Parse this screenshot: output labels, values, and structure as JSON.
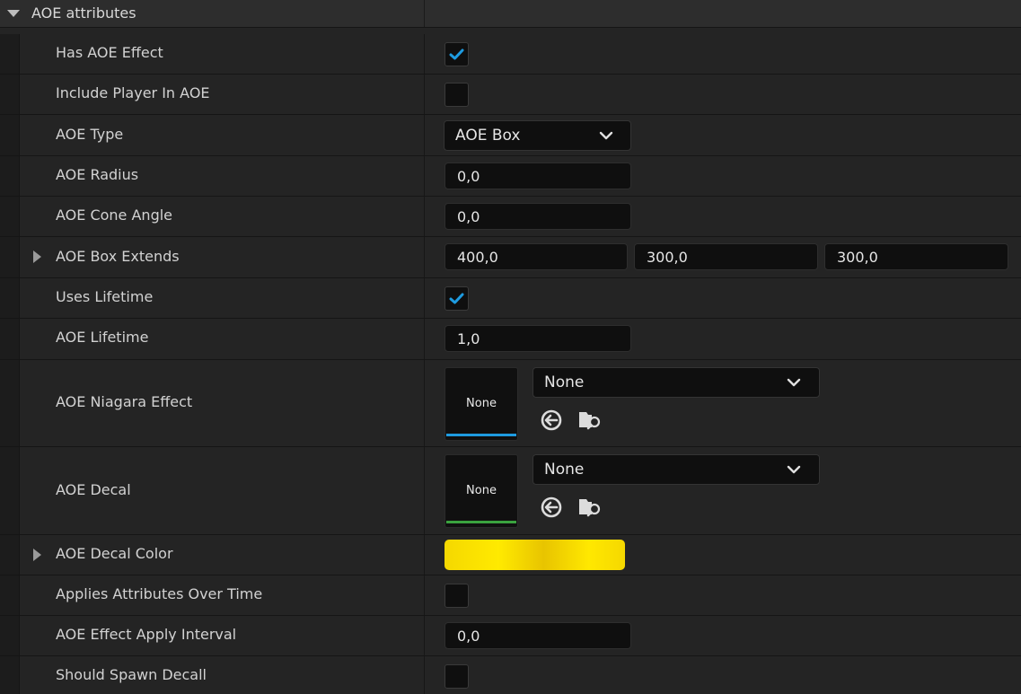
{
  "section": {
    "title": "AOE attributes"
  },
  "rows": {
    "has_aoe_effect": {
      "label": "Has AOE Effect",
      "checked": true
    },
    "include_player": {
      "label": "Include Player In AOE",
      "checked": false
    },
    "aoe_type": {
      "label": "AOE Type",
      "value": "AOE Box"
    },
    "aoe_radius": {
      "label": "AOE Radius",
      "value": "0,0"
    },
    "aoe_cone_angle": {
      "label": "AOE Cone Angle",
      "value": "0,0"
    },
    "aoe_box_extends": {
      "label": "AOE Box Extends",
      "x": "400,0",
      "y": "300,0",
      "z": "300,0"
    },
    "uses_lifetime": {
      "label": "Uses Lifetime",
      "checked": true
    },
    "aoe_lifetime": {
      "label": "AOE Lifetime",
      "value": "1,0"
    },
    "aoe_niagara_effect": {
      "label": "AOE Niagara Effect",
      "thumb_text": "None",
      "value": "None",
      "accent": "#1e9be0"
    },
    "aoe_decal": {
      "label": "AOE Decal",
      "thumb_text": "None",
      "value": "None",
      "accent": "#3aa23f"
    },
    "aoe_decal_color": {
      "label": "AOE Decal Color",
      "color": "#f5d800"
    },
    "applies_over_time": {
      "label": "Applies Attributes Over Time",
      "checked": false
    },
    "apply_interval": {
      "label": "AOE Effect Apply Interval",
      "value": "0,0"
    },
    "should_spawn_decal": {
      "label": "Should Spawn Decall",
      "checked": false
    }
  },
  "icons": {
    "check": "checkmark-icon",
    "dropdown": "chevron-down-icon",
    "use_selected": "use-selected-asset-icon",
    "browse": "browse-asset-icon",
    "expand": "expand-arrow-icon",
    "collapse": "collapse-arrow-icon"
  },
  "colors": {
    "check": "#1e9be0",
    "panel": "#242424",
    "field": "#0f0f0f"
  }
}
